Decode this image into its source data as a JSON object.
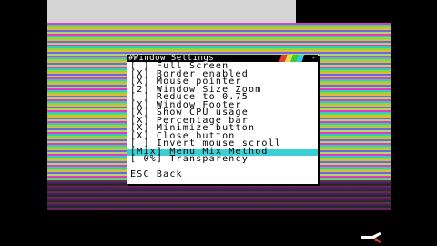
{
  "window": {
    "title": "Window Settings",
    "icon": "# ",
    "close": "-"
  },
  "menu": [
    {
      "label": "[ ] Full Screen"
    },
    {
      "label": "[X] Border enabled"
    },
    {
      "label": "[X] Mouse pointer"
    },
    {
      "label": "[2] Window Size Zoom"
    },
    {
      "label": "[ ] Reduce to 0.75"
    },
    {
      "label": "[X] Window Footer"
    },
    {
      "label": "[X] Show CPU usage"
    },
    {
      "label": "[X] Percentage bar"
    },
    {
      "label": "[X] Minimize button"
    },
    {
      "label": "[X] Close button"
    },
    {
      "label": "[ ] Invert mouse scroll"
    },
    {
      "label": "[Mix] Menu Mix Method",
      "selected": true
    },
    {
      "label": "[ 0%] Transparency"
    }
  ],
  "footer": {
    "esc_label": "ESC Back"
  },
  "colors": {
    "selection": "#3bd0d6",
    "titlebar": "#000000"
  }
}
